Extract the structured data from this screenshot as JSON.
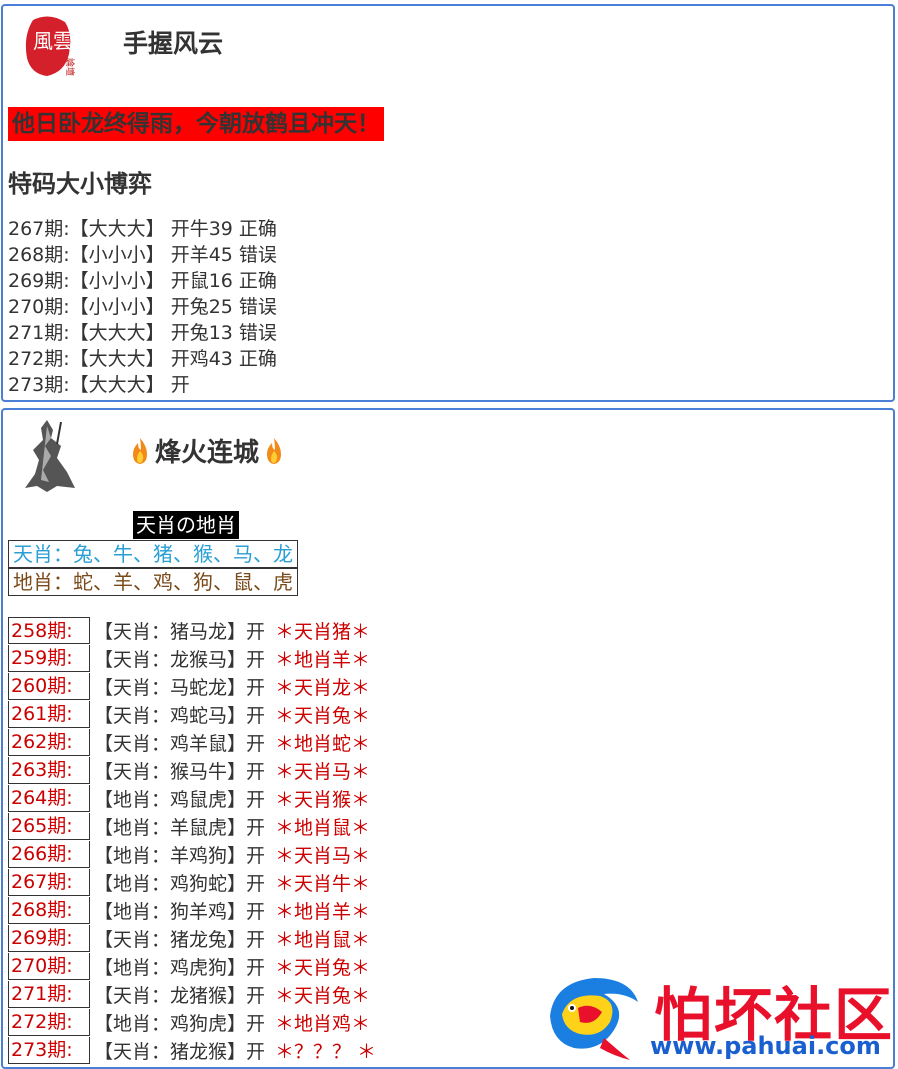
{
  "panel1": {
    "forum_title": "手握风云",
    "avatar_text": "風雲",
    "avatar_small_text": "論壇",
    "slogan": "他日卧龙终得雨，今朝放鹤且冲天！",
    "section_title": "特码大小博弈",
    "records": [
      "267期:【大大大】 开牛39 正确",
      "268期:【小小小】 开羊45 错误",
      "269期:【小小小】 开鼠16 正确",
      "270期:【小小小】 开兔25 错误",
      "271期:【大大大】 开兔13 错误",
      "272期:【大大大】 开鸡43 正确",
      "273期:【大大大】 开"
    ]
  },
  "panel2": {
    "forum_title": "烽火连城",
    "tag": "天肖の地肖",
    "zodiac_sky": "天肖：兔、牛、猪、猴、马、龙",
    "zodiac_earth": "地肖：蛇、羊、鸡、狗、鼠、虎",
    "predictions": [
      {
        "period": "258期:",
        "text": "【天肖：猪马龙】开",
        "result": "＊天肖猪＊"
      },
      {
        "period": "259期:",
        "text": "【天肖：龙猴马】开",
        "result": "＊地肖羊＊"
      },
      {
        "period": "260期:",
        "text": "【天肖：马蛇龙】开",
        "result": "＊天肖龙＊"
      },
      {
        "period": "261期:",
        "text": "【天肖：鸡蛇马】开",
        "result": "＊天肖兔＊"
      },
      {
        "period": "262期:",
        "text": "【天肖：鸡羊鼠】开",
        "result": "＊地肖蛇＊"
      },
      {
        "period": "263期:",
        "text": "【天肖：猴马牛】开",
        "result": "＊天肖马＊"
      },
      {
        "period": "264期:",
        "text": "【地肖：鸡鼠虎】开",
        "result": "＊天肖猴＊"
      },
      {
        "period": "265期:",
        "text": "【地肖：羊鼠虎】开",
        "result": "＊地肖鼠＊"
      },
      {
        "period": "266期:",
        "text": "【地肖：羊鸡狗】开",
        "result": "＊天肖马＊"
      },
      {
        "period": "267期:",
        "text": "【地肖：鸡狗蛇】开",
        "result": "＊天肖牛＊"
      },
      {
        "period": "268期:",
        "text": "【地肖：狗羊鸡】开",
        "result": "＊地肖羊＊"
      },
      {
        "period": "269期:",
        "text": "【天肖：猪龙兔】开",
        "result": "＊地肖鼠＊"
      },
      {
        "period": "270期:",
        "text": "【地肖：鸡虎狗】开",
        "result": "＊天肖兔＊"
      },
      {
        "period": "271期:",
        "text": "【天肖：龙猪猴】开",
        "result": "＊天肖兔＊"
      },
      {
        "period": "272期:",
        "text": "【地肖：鸡狗虎】开",
        "result": "＊地肖鸡＊"
      },
      {
        "period": "273期:",
        "text": "【天肖：猪龙猴】开",
        "result": "＊？？？ ＊"
      }
    ]
  },
  "watermark": {
    "title": "怕坏社区",
    "url": "www.pahuai.com"
  },
  "colors": {
    "panel_border": "#4a7fd6",
    "slogan_bg": "#ff0000",
    "result_red": "#cc0000",
    "sky_blue": "#2a9fd6",
    "earth_brown": "#7a4a1a",
    "watermark_red": "#e8102a",
    "watermark_blue": "#1a5fd0"
  }
}
